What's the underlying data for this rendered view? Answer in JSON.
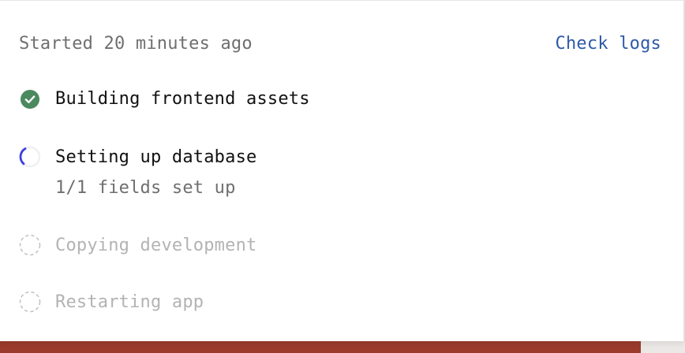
{
  "header": {
    "started_text": "Started 20 minutes ago",
    "check_logs_label": "Check logs"
  },
  "steps": [
    {
      "label": "Building frontend assets",
      "status": "done"
    },
    {
      "label": "Setting up database",
      "status": "in-progress",
      "detail": "1/1 fields set up"
    },
    {
      "label": "Copying development",
      "status": "pending"
    },
    {
      "label": "Restarting app",
      "status": "pending"
    }
  ],
  "colors": {
    "done_green": "#4a8a5e",
    "spinner_blue": "#3f3fe0",
    "link_blue": "#2e5aa7",
    "pending_gray": "#b3b3b3",
    "backdrop_red": "#9b3b2c"
  }
}
